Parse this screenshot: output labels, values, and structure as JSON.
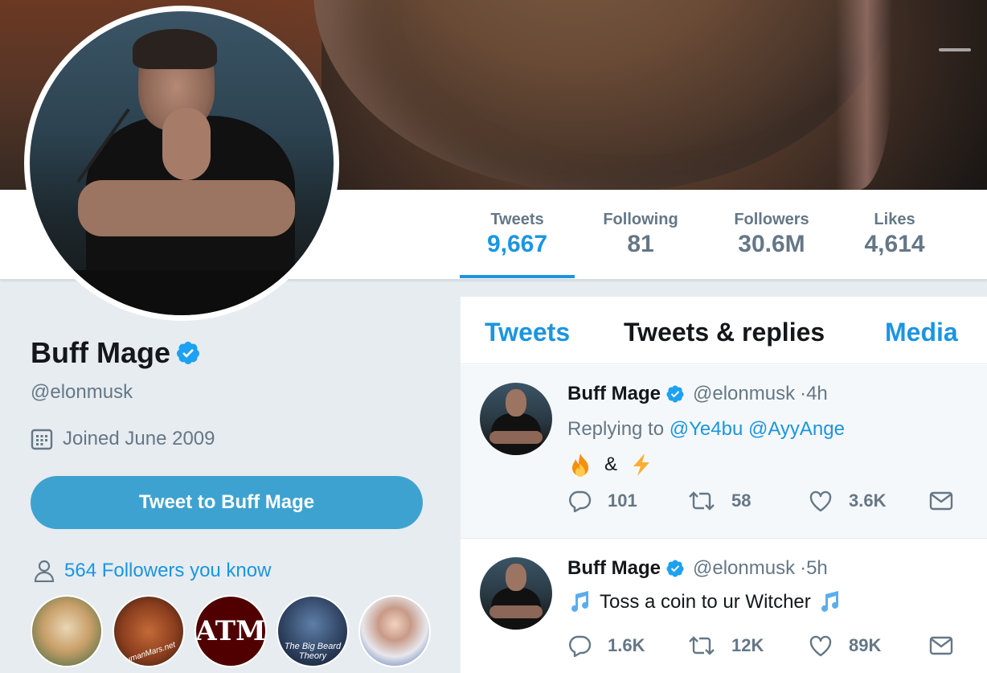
{
  "profile": {
    "name": "Buff Mage",
    "handle": "@elonmusk",
    "joined": "Joined June 2009",
    "tweet_to_label": "Tweet to Buff Mage",
    "followers_you_know": "564 Followers you know",
    "mutuals": [
      {
        "icon": "hamster-avatar"
      },
      {
        "icon": "humanmarsnet-avatar",
        "text": "humanMars.net"
      },
      {
        "icon": "texas-am-avatar",
        "text": "ATM"
      },
      {
        "icon": "big-beard-theory-avatar",
        "text": "The Big Beard Theory"
      },
      {
        "icon": "cosmonaut-avatar"
      }
    ]
  },
  "stats": {
    "tweets": {
      "label": "Tweets",
      "value": "9,667"
    },
    "following": {
      "label": "Following",
      "value": "81"
    },
    "followers": {
      "label": "Followers",
      "value": "30.6M"
    },
    "likes": {
      "label": "Likes",
      "value": "4,614"
    }
  },
  "tabs": {
    "tweets": "Tweets",
    "replies": "Tweets & replies",
    "media": "Media"
  },
  "tweets": [
    {
      "name": "Buff Mage",
      "handle": "@elonmusk",
      "time": "·4h",
      "reply_prefix": "Replying to",
      "mention1": "@Ye4bu",
      "mention2": "@AyyAnge",
      "text_mid": "&",
      "replies": "101",
      "retweets": "58",
      "likes": "3.6K"
    },
    {
      "name": "Buff Mage",
      "handle": "@elonmusk",
      "time": "·5h",
      "text": "Toss a coin to ur Witcher",
      "replies": "1.6K",
      "retweets": "12K",
      "likes": "89K"
    }
  ],
  "colors": {
    "accent": "#1b95e0",
    "button": "#3ea2d0",
    "muted": "#657786",
    "background": "#e6ecf0"
  }
}
